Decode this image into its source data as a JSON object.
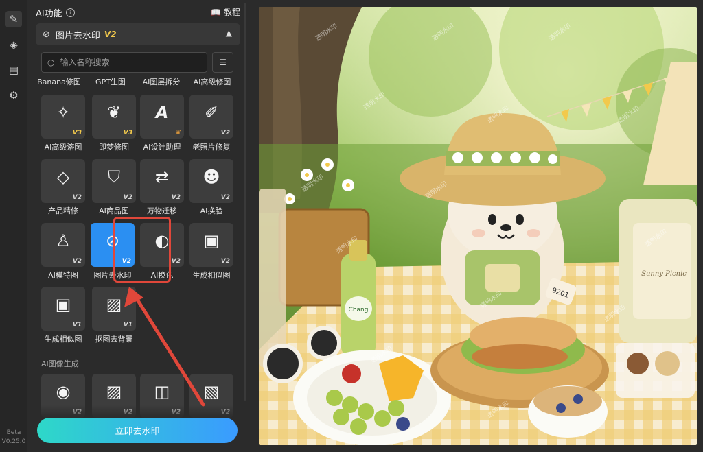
{
  "rail": {
    "items": [
      {
        "name": "edit-icon",
        "glyph": "✎",
        "active": true
      },
      {
        "name": "layers-icon",
        "glyph": "◈",
        "active": false
      },
      {
        "name": "clipboard-icon",
        "glyph": "▤",
        "active": false
      },
      {
        "name": "gear-icon",
        "glyph": "⚙",
        "active": false
      }
    ],
    "beta": "Beta",
    "version": "V0.25.0"
  },
  "panel": {
    "title": "AI功能",
    "tutorial": "教程",
    "section": {
      "title": "图片去水印",
      "version": "V2"
    },
    "search_placeholder": "输入名称搜索",
    "top_labels": [
      "Banana修图",
      "GPT生图",
      "AI图层拆分",
      "AI高级修图"
    ],
    "tools": [
      {
        "label": "AI高级溶图",
        "icon": "sparkle-image-icon",
        "glyph": "✧",
        "version": "V3",
        "gold": true
      },
      {
        "label": "即梦修图",
        "icon": "dreamina-icon",
        "glyph": "❦",
        "version": "V3",
        "gold": true
      },
      {
        "label": "AI设计助理",
        "icon": "design-assistant-icon",
        "glyph": "A",
        "version": "",
        "crown": true
      },
      {
        "label": "老照片修复",
        "icon": "photo-restore-icon",
        "glyph": "✐",
        "version": "V2"
      },
      {
        "label": "产品精修",
        "icon": "diamond-icon",
        "glyph": "◇",
        "version": "V2"
      },
      {
        "label": "AI商品图",
        "icon": "shopping-bag-icon",
        "glyph": "⛉",
        "version": "V2"
      },
      {
        "label": "万物迁移",
        "icon": "transfer-icon",
        "glyph": "⇄",
        "version": "V2"
      },
      {
        "label": "AI换脸",
        "icon": "face-swap-icon",
        "glyph": "☻",
        "version": "V2"
      },
      {
        "label": "AI模特图",
        "icon": "model-icon",
        "glyph": "♙",
        "version": "V2"
      },
      {
        "label": "图片去水印",
        "icon": "watermark-remove-icon",
        "glyph": "⊘",
        "version": "V2",
        "selected": true
      },
      {
        "label": "AI换色",
        "icon": "palette-icon",
        "glyph": "◐",
        "version": "V2"
      },
      {
        "label": "生成相似图",
        "icon": "similar-image-icon",
        "glyph": "▣",
        "version": "V2"
      },
      {
        "label": "生成相似图",
        "icon": "similar-image-icon",
        "glyph": "▣",
        "version": "V1"
      },
      {
        "label": "抠图去背景",
        "icon": "cutout-icon",
        "glyph": "▨",
        "version": "V1"
      }
    ],
    "subsection": "AI图像生成",
    "gen_tools": [
      {
        "icon": "swirl-icon",
        "glyph": "◉",
        "version": "V2"
      },
      {
        "icon": "image-text-icon",
        "glyph": "▨",
        "version": "V2"
      },
      {
        "icon": "image-stack-icon",
        "glyph": "◫",
        "version": "V2"
      },
      {
        "icon": "image-edit-icon",
        "glyph": "▧",
        "version": "V2"
      }
    ],
    "cta": "立即去水印"
  },
  "canvas": {
    "watermark_text": "透明水印",
    "image_texts": {
      "bottle_brand": "Chang",
      "box_text": "Sunny Picnic",
      "tag_text": "9201"
    }
  }
}
